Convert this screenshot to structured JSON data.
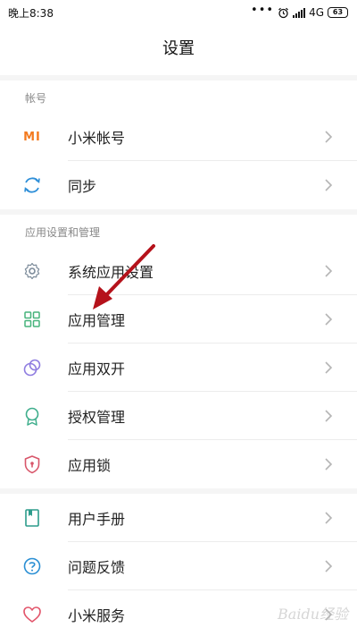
{
  "status_bar": {
    "time": "晚上8:38",
    "dots": "•••",
    "network": "4G",
    "battery": "63"
  },
  "header": {
    "title": "设置"
  },
  "sections": [
    {
      "header": "帐号",
      "items": [
        {
          "label": "小米帐号",
          "icon": "mi-logo-icon",
          "icon_text": "MI"
        },
        {
          "label": "同步",
          "icon": "sync-icon"
        }
      ]
    },
    {
      "header": "应用设置和管理",
      "items": [
        {
          "label": "系统应用设置",
          "icon": "gear-icon"
        },
        {
          "label": "应用管理",
          "icon": "grid-apps-icon"
        },
        {
          "label": "应用双开",
          "icon": "dual-apps-icon"
        },
        {
          "label": "授权管理",
          "icon": "ribbon-badge-icon"
        },
        {
          "label": "应用锁",
          "icon": "shield-lock-icon"
        }
      ]
    },
    {
      "header": "",
      "items": [
        {
          "label": "用户手册",
          "icon": "book-icon"
        },
        {
          "label": "问题反馈",
          "icon": "question-icon"
        },
        {
          "label": "小米服务",
          "icon": "heart-icon"
        }
      ]
    }
  ],
  "colors": {
    "mi_orange": "#f37a1f",
    "sync_blue": "#2f8fd8",
    "gear_gray": "#7b8a99",
    "apps_green": "#46b37b",
    "dual_purple": "#8f7de0",
    "ribbon_teal": "#3fae8c",
    "lock_red": "#d8566a",
    "book_teal": "#2d9c8c",
    "question_blue": "#2a8fd4",
    "heart_red": "#e2546a",
    "arrow_red": "#b5121b"
  },
  "watermark": "Baidu经验"
}
